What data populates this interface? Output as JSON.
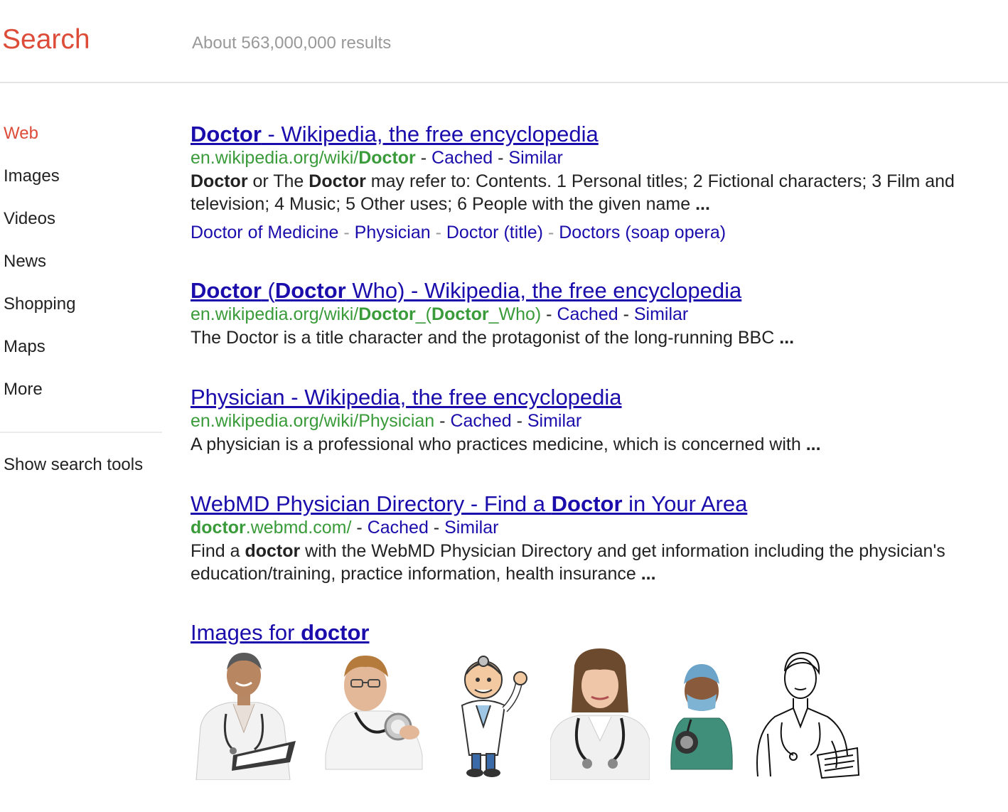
{
  "header": {
    "brand": "Search",
    "result_stats": "About 563,000,000 results"
  },
  "leftnav": {
    "items": [
      {
        "label": "Web",
        "active": true
      },
      {
        "label": "Images"
      },
      {
        "label": "Videos"
      },
      {
        "label": "News"
      },
      {
        "label": "Shopping"
      },
      {
        "label": "Maps"
      },
      {
        "label": "More"
      }
    ],
    "tools_label": "Show search tools"
  },
  "results": [
    {
      "title_parts": [
        "Doctor",
        " - Wikipedia, the free encyclopedia"
      ],
      "url_parts": [
        "en.wikipedia.org/wiki/",
        "Doctor"
      ],
      "cached": "Cached",
      "similar": "Similar",
      "snippet_parts": [
        "Doctor",
        " or The ",
        "Doctor",
        " may refer to: Contents. 1 Personal titles; 2 Fictional characters; 3 Film and television; 4 Music; 5 Other uses; 6 People with the given name ",
        "..."
      ],
      "sitelinks": [
        "Doctor of Medicine",
        "Physician",
        "Doctor (title)",
        "Doctors (soap opera)"
      ]
    },
    {
      "title_parts": [
        "Doctor",
        " (",
        "Doctor",
        " Who) - Wikipedia, the free encyclopedia"
      ],
      "url_parts": [
        "en.wikipedia.org/wiki/",
        "Doctor",
        "_(",
        "Doctor",
        "_Who)"
      ],
      "cached": "Cached",
      "similar": "Similar",
      "snippet_parts": [
        "The Doctor is a title character and the protagonist of the long-running BBC ",
        "..."
      ]
    },
    {
      "title_parts": [
        "Physician - Wikipedia, the free encyclopedia"
      ],
      "url_parts": [
        "en.wikipedia.org/wiki/Physician"
      ],
      "cached": "Cached",
      "similar": "Similar",
      "snippet_parts": [
        "A physician is a professional who practices medicine, which is concerned with ",
        "..."
      ]
    },
    {
      "title_parts": [
        "WebMD Physician Directory - Find a ",
        "Doctor",
        " in Your Area"
      ],
      "url_parts": [
        "doctor",
        ".webmd.com/"
      ],
      "cached": "Cached",
      "similar": "Similar",
      "snippet_parts": [
        "Find a ",
        "doctor",
        " with the WebMD Physician Directory and get information including the physician's education/training, practice information, health insurance ",
        "..."
      ]
    }
  ],
  "images_block": {
    "title_parts": [
      "Images for ",
      "doctor"
    ],
    "thumbnails": [
      {
        "icon": "doctor-clipboard-photo"
      },
      {
        "icon": "doctor-stethoscope-photo"
      },
      {
        "icon": "cartoon-doctor-waving"
      },
      {
        "icon": "female-doctor-photo"
      },
      {
        "icon": "surgeon-scrubs-photo"
      },
      {
        "icon": "doctor-line-drawing"
      }
    ]
  },
  "colors": {
    "brand": "#dd4b39",
    "link": "#1a0dab",
    "url": "#3a9b3a",
    "stats": "#999999"
  }
}
